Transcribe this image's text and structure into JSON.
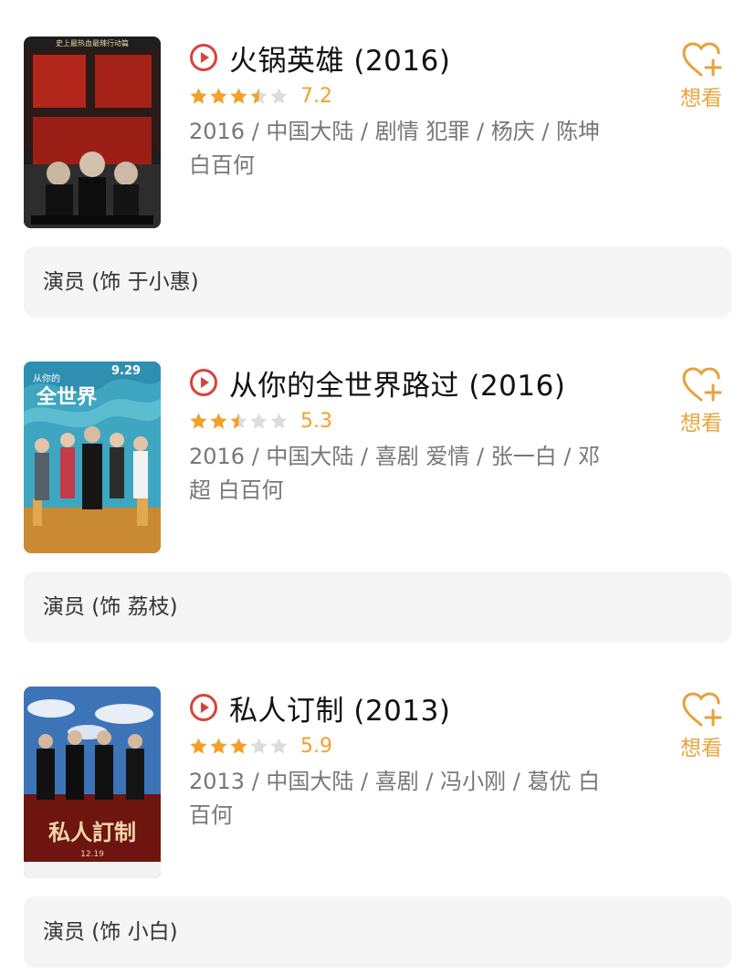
{
  "colors": {
    "accent": "#f3a02a",
    "play": "#d9423a",
    "role_bg": "#f5f5f5",
    "meta": "#777777"
  },
  "movies": [
    {
      "title": "火锅英雄",
      "year": "(2016)",
      "rating": 7.2,
      "stars_filled": 3.5,
      "score": "7.2",
      "meta": "2016 / 中国大陆 / 剧情 犯罪 / 杨庆 / 陈坤 白百何",
      "want_label": "想看",
      "role": "演员 (饰 于小惠)",
      "poster_palette": {
        "bg": "#1e1e1e",
        "band": "#b3271d"
      }
    },
    {
      "title": "从你的全世界路过",
      "year": "(2016)",
      "rating": 5.3,
      "stars_filled": 2.5,
      "score": "5.3",
      "meta": "2016 / 中国大陆 / 喜剧 爱情 / 张一白 / 邓超 白百何",
      "want_label": "想看",
      "role": "演员 (饰 荔枝)",
      "poster_palette": {
        "bg": "#3fa6c1",
        "band": "#d9a441"
      }
    },
    {
      "title": "私人订制",
      "year": "(2013)",
      "rating": 5.9,
      "stars_filled": 3,
      "score": "5.9",
      "meta": "2013 / 中国大陆 / 喜剧 / 冯小刚 / 葛优 白百何",
      "want_label": "想看",
      "role": "演员 (饰 小白)",
      "poster_palette": {
        "bg": "#3d74b8",
        "band": "#6e1510"
      }
    }
  ]
}
